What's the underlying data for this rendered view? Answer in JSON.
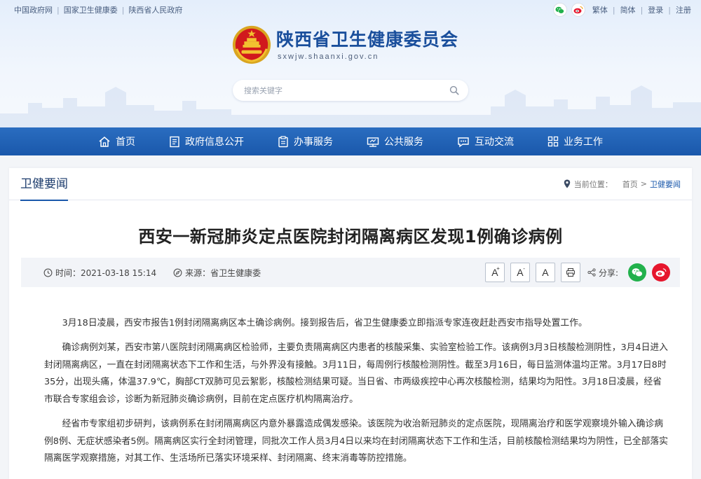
{
  "toplinks": [
    "中国政府网",
    "国家卫生健康委",
    "陕西省人民政府"
  ],
  "topright": {
    "icons": [
      "wechat-icon",
      "weibo-icon"
    ],
    "links": [
      "繁体",
      "简体",
      "登录",
      "注册"
    ]
  },
  "logo": {
    "title": "陕西省卫生健康委员会",
    "domain": "sxwjw.shaanxi.gov.cn"
  },
  "search": {
    "placeholder": "搜索关键字",
    "value": ""
  },
  "nav": {
    "items": [
      {
        "label": "首页",
        "icon": "home-icon"
      },
      {
        "label": "政府信息公开",
        "icon": "document-list-icon"
      },
      {
        "label": "办事服务",
        "icon": "clipboard-icon"
      },
      {
        "label": "公共服务",
        "icon": "public-service-icon"
      },
      {
        "label": "互动交流",
        "icon": "chat-bubble-icon"
      },
      {
        "label": "业务工作",
        "icon": "grid-icon"
      }
    ]
  },
  "section": {
    "title": "卫健要闻",
    "breadcrumb_label": "当前位置：",
    "breadcrumb": [
      "首页",
      "卫健要闻"
    ],
    "breadcrumb_separator": ">"
  },
  "article": {
    "title": "西安一新冠肺炎定点医院封闭隔离病区发现1例确诊病例",
    "time": "时间：2021-03-18 15:14",
    "source": "来源：省卫生健康委",
    "font_buttons": {
      "larger": "A",
      "smaller": "A",
      "normal": "A",
      "larger_sup": "+",
      "smaller_sup": "-"
    },
    "share_label": "分享:",
    "paragraphs": [
      "3月18日凌晨，西安市报告1例封闭隔离病区本土确诊病例。接到报告后，省卫生健康委立即指派专家连夜赶赴西安市指导处置工作。",
      "确诊病例刘某，西安市第八医院封闭隔离病区检验师，主要负责隔离病区内患者的核酸采集、实验室检验工作。该病例3月3日核酸检测阴性，3月4日进入封闭隔离病区，一直在封闭隔离状态下工作和生活，与外界没有接触。3月11日，每周例行核酸检测阴性。截至3月16日，每日监测体温均正常。3月17日8时35分，出现头痛，体温37.9℃，胸部CT双肺可见云絮影，核酸检测结果可疑。当日省、市两级疾控中心再次核酸检测，结果均为阳性。3月18日凌晨，经省市联合专家组会诊，诊断为新冠肺炎确诊病例，目前在定点医疗机构隔离治疗。",
      "经省市专家组初步研判，该病例系在封闭隔离病区内意外暴露造成偶发感染。该医院为收治新冠肺炎的定点医院，现隔离治疗和医学观察境外输入确诊病例8例、无症状感染者5例。隔离病区实行全封闭管理，同批次工作人员3月4日以来均在封闭隔离状态下工作和生活，目前核酸检测结果均为阴性，已全部落实隔离医学观察措施，对其工作、生活场所已落实环境采样、封闭隔离、终末消毒等防控措施。"
    ]
  },
  "colors": {
    "nav_blue": "#1a58ab",
    "title_blue": "#1a4f9c",
    "wechat_green": "#22b14c",
    "weibo_red": "#e6162d"
  }
}
